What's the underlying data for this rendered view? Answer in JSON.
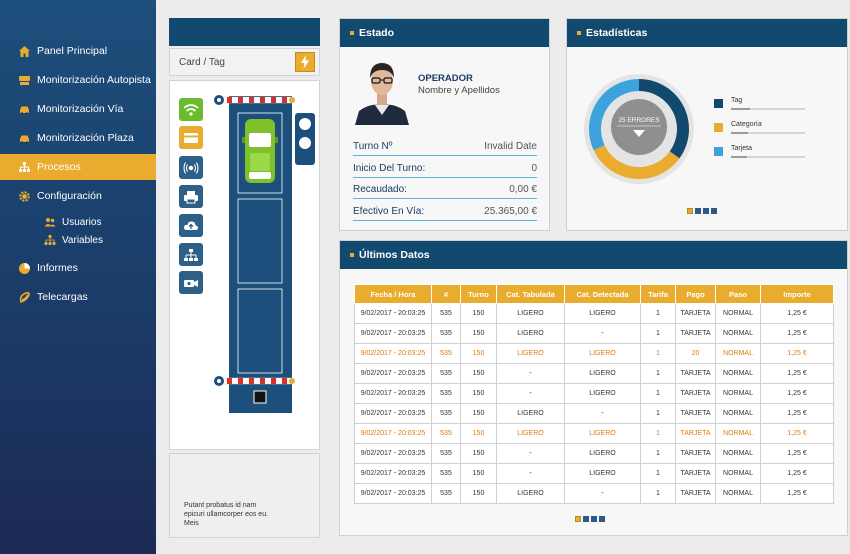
{
  "sidebar": {
    "items": [
      {
        "label": "Panel Principal",
        "icon": "home-icon"
      },
      {
        "label": "Monitorización Autopista",
        "icon": "highway-icon"
      },
      {
        "label": "Monitorización Vía",
        "icon": "car-icon"
      },
      {
        "label": "Monitorización Plaza",
        "icon": "car-icon"
      },
      {
        "label": "Procesos",
        "icon": "process-icon"
      },
      {
        "label": "Configuración",
        "icon": "gear-icon"
      },
      {
        "label": "Informes",
        "icon": "pie-icon"
      },
      {
        "label": "Telecargas",
        "icon": "swoosh-icon"
      }
    ],
    "subitems": [
      {
        "label": "Usuarios",
        "icon": "users-icon"
      },
      {
        "label": "Variables",
        "icon": "network-icon"
      }
    ],
    "active": "Procesos"
  },
  "left": {
    "card_tag_label": "Card / Tag",
    "note": "Putant probatus id nam epicuri ullamcorper eos eu. Meis"
  },
  "estado": {
    "title": "Estado",
    "operator_role": "OPERADOR",
    "operator_name": "Nombre y Apellidos",
    "rows": [
      {
        "key": "Turno Nº",
        "value": "Invalid Date"
      },
      {
        "key": "Inicio Del Turno:",
        "value": "0"
      },
      {
        "key": "Recaudado:",
        "value": "0,00 €"
      },
      {
        "key": "Efectivo En Vía:",
        "value": "25.365,00 €"
      }
    ]
  },
  "estadisticas": {
    "title": "Estadísticas",
    "center_label": "25 ERRORES",
    "legend": [
      {
        "label": "Tag",
        "color": "#114a6e",
        "share": 0.35
      },
      {
        "label": "Categoría",
        "color": "#e9ac2f",
        "share": 0.33
      },
      {
        "label": "Tarjeta",
        "color": "#3ea3dc",
        "share": 0.32
      }
    ]
  },
  "ultimos": {
    "title": "Últimos Datos",
    "headers": [
      "Fecha / Hora",
      "#",
      "Turno",
      "Cat. Tabulada",
      "Cat. Detectada",
      "Tarifa",
      "Pago",
      "Paso",
      "Importe"
    ],
    "rows": [
      [
        "9/02/2017  - 20:03:25",
        "535",
        "150",
        "LIGERO",
        "LIGERO",
        "1",
        "TARJETA",
        "NORMAL",
        "1,25 €"
      ],
      [
        "9/02/2017  - 20:03:25",
        "535",
        "150",
        "LIGERO",
        "-",
        "1",
        "TARJETA",
        "NORMAL",
        "1,25 €"
      ],
      [
        "9/02/2017  - 20:03:25",
        "535",
        "150",
        "LIGERO",
        "LIGERO",
        "1",
        "20",
        "NORMAL",
        "1,25 €"
      ],
      [
        "9/02/2017  - 20:03:25",
        "535",
        "150",
        "-",
        "LIGERO",
        "1",
        "TARJETA",
        "NORMAL",
        "1,25 €"
      ],
      [
        "9/02/2017  - 20:03:25",
        "535",
        "150",
        "-",
        "LIGERO",
        "1",
        "TARJETA",
        "NORMAL",
        "1,25 €"
      ],
      [
        "9/02/2017  - 20:03:25",
        "535",
        "150",
        "LIGERO",
        "-",
        "1",
        "TARJETA",
        "NORMAL",
        "1,25 €"
      ],
      [
        "9/02/2017  - 20:03:25",
        "535",
        "150",
        "LIGERO",
        "LIGERO",
        "1",
        "TARJETA",
        "NORMAL",
        "1,25 €"
      ],
      [
        "9/02/2017  - 20:03:25",
        "535",
        "150",
        "-",
        "LIGERO",
        "1",
        "TARJETA",
        "NORMAL",
        "1,25 €"
      ],
      [
        "9/02/2017  - 20:03:25",
        "535",
        "150",
        "-",
        "LIGERO",
        "1",
        "TARJETA",
        "NORMAL",
        "1,25 €"
      ],
      [
        "9/02/2017  - 20:03:25",
        "535",
        "150",
        "LIGERO",
        "-",
        "1",
        "TARJETA",
        "NORMAL",
        "1,25 €"
      ]
    ],
    "highlighted_rows": [
      2,
      6
    ]
  },
  "colors": {
    "accent": "#e9ac2f",
    "header_blue": "#114a6e",
    "alert_orange": "#e07a12",
    "lane_blue": "#1d4f7c"
  }
}
